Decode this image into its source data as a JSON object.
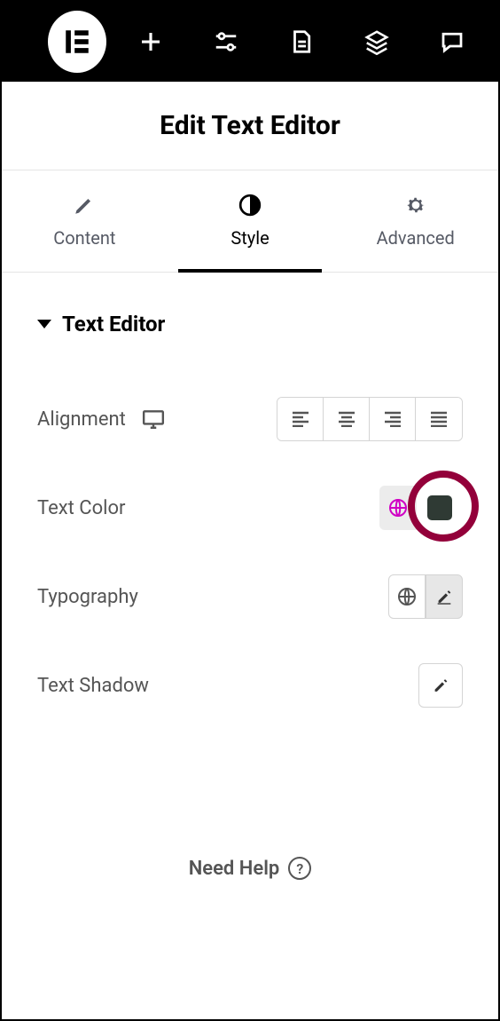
{
  "title": "Edit Text Editor",
  "tabs": {
    "content": "Content",
    "style": "Style",
    "advanced": "Advanced"
  },
  "section": {
    "title": "Text Editor"
  },
  "rows": {
    "alignment_label": "Alignment",
    "text_color_label": "Text Color",
    "typography_label": "Typography",
    "text_shadow_label": "Text Shadow"
  },
  "colors": {
    "text_color_swatch": "#2f3a34",
    "globe_active": "#d000c4",
    "highlight_ring": "#93003a"
  },
  "help": {
    "label": "Need Help",
    "icon_glyph": "?"
  }
}
